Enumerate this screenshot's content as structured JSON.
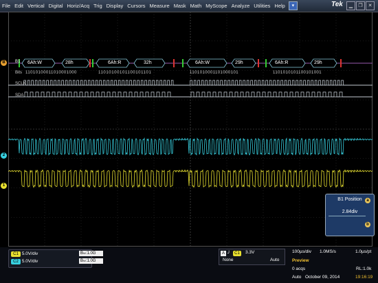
{
  "menu": [
    "File",
    "Edit",
    "Vertical",
    "Digital",
    "Horiz/Acq",
    "Trig",
    "Display",
    "Cursors",
    "Measure",
    "Mask",
    "Math",
    "MyScope",
    "Analyze",
    "Utilities",
    "Help"
  ],
  "brand": "Tek",
  "bus": {
    "label": "B1",
    "packets": [
      {
        "address": "6Ah:W",
        "data": "28h",
        "address2": "6Ah:R",
        "data2": "32h"
      },
      {
        "address": "6Ah:W",
        "data": "29h",
        "address2": "6Ah:R",
        "data2": "29h"
      }
    ],
    "bits_label": "Bits",
    "bits_a": "11010100011010001000",
    "bits_b": "11010100101100101101",
    "bits_c": "1101010001101000101",
    "bits_d": "1101010101100101001",
    "scl_label": "SCLK",
    "sda_label": "SDA"
  },
  "channel_markers": {
    "ch2": "2",
    "ch1": "1",
    "bus": "B"
  },
  "position_panel": {
    "title": "B1 Position",
    "value": "2.84div",
    "a": "a",
    "b": "b"
  },
  "channels": [
    {
      "name": "C1",
      "scale": "5.0V/div",
      "bw": "1.0G",
      "color": "#e8e030"
    },
    {
      "name": "C2",
      "scale": "5.0V/div",
      "bw": "1.0G",
      "color": "#38d0e0"
    }
  ],
  "bw_label": "B",
  "trigger": {
    "source": "C1",
    "level": "3.3V",
    "coupling": "None",
    "mode": "Auto"
  },
  "acq": {
    "timebase": "100µs/div",
    "sample_rate": "1.0MS/s",
    "resolution": "1.0µs/pt",
    "state": "Preview",
    "acqs": "0 acqs",
    "record": "RL:1.0k",
    "mode": "Auto",
    "date": "October 09, 2014",
    "time": "19:16:19"
  }
}
